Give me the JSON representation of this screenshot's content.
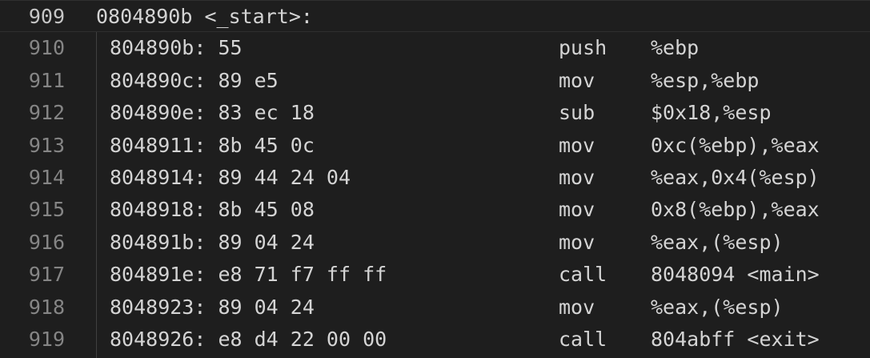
{
  "header": {
    "line_number": "909",
    "text": "0804890b <_start>:"
  },
  "lines": [
    {
      "number": "910",
      "address_bytes": "804890b: 55",
      "mnemonic": "push",
      "operands": "%ebp"
    },
    {
      "number": "911",
      "address_bytes": "804890c: 89 e5",
      "mnemonic": "mov",
      "operands": "%esp,%ebp"
    },
    {
      "number": "912",
      "address_bytes": "804890e: 83 ec 18",
      "mnemonic": "sub",
      "operands": "$0x18,%esp"
    },
    {
      "number": "913",
      "address_bytes": "8048911: 8b 45 0c",
      "mnemonic": "mov",
      "operands": "0xc(%ebp),%eax"
    },
    {
      "number": "914",
      "address_bytes": "8048914: 89 44 24 04",
      "mnemonic": "mov",
      "operands": "%eax,0x4(%esp)"
    },
    {
      "number": "915",
      "address_bytes": "8048918: 8b 45 08",
      "mnemonic": "mov",
      "operands": "0x8(%ebp),%eax"
    },
    {
      "number": "916",
      "address_bytes": "804891b: 89 04 24",
      "mnemonic": "mov",
      "operands": "%eax,(%esp)"
    },
    {
      "number": "917",
      "address_bytes": "804891e: e8 71 f7 ff ff",
      "mnemonic": "call",
      "operands": "8048094 <main>"
    },
    {
      "number": "918",
      "address_bytes": "8048923: 89 04 24",
      "mnemonic": "mov",
      "operands": "%eax,(%esp)"
    },
    {
      "number": "919",
      "address_bytes": "8048926: e8 d4 22 00 00",
      "mnemonic": "call",
      "operands": "804abff <exit>"
    }
  ]
}
